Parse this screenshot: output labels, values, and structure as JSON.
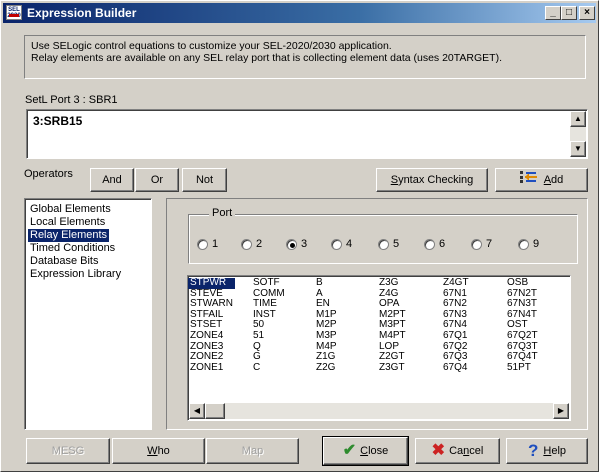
{
  "window": {
    "title": "Expression Builder",
    "icon_text": "SEL 2030",
    "controls": {
      "minimize": "_",
      "maximize": "□",
      "close": "×"
    }
  },
  "info": {
    "line1": "Use SELogic control equations to customize your SEL-2020/2030 application.",
    "line2": "Relay elements are available on any SEL relay port that is collecting element data (uses 20TARGET)."
  },
  "setting": {
    "label": "SetL  Port 3 : SBR1",
    "expression": "3:SRB15"
  },
  "operators": {
    "label": "Operators",
    "and": "And",
    "or": "Or",
    "not": "Not",
    "syntax_prefix": "S",
    "syntax_rest": "yntax Checking",
    "add_prefix": "A",
    "add_rest": "dd"
  },
  "categories": {
    "items": [
      "Global Elements",
      "Local Elements",
      "Relay Elements",
      "Timed Conditions",
      "Database Bits",
      "Expression Library"
    ],
    "selected_index": 2
  },
  "port": {
    "legend": "Port",
    "options": [
      "1",
      "2",
      "3",
      "4",
      "5",
      "6",
      "7",
      "9"
    ],
    "selected": "3"
  },
  "elements": {
    "columns": [
      [
        "STPWR",
        "STEVE",
        "STWARN",
        "STFAIL",
        "STSET",
        "ZONE4",
        "ZONE3",
        "ZONE2",
        "ZONE1"
      ],
      [
        "SOTF",
        "COMM",
        "TIME",
        "INST",
        "50",
        "51",
        "Q",
        "G",
        "C"
      ],
      [
        "B",
        "A",
        "EN",
        "M1P",
        "M2P",
        "M3P",
        "M4P",
        "Z1G",
        "Z2G"
      ],
      [
        "Z3G",
        "Z4G",
        "OPA",
        "M2PT",
        "M3PT",
        "M4PT",
        "LOP",
        "Z2GT",
        "Z3GT"
      ],
      [
        "Z4GT",
        "67N1",
        "67N2",
        "67N3",
        "67N4",
        "67Q1",
        "67Q2",
        "67Q3",
        "67Q4"
      ],
      [
        "OSB",
        "67N2T",
        "67N3T",
        "67N4T",
        "OST",
        "67Q2T",
        "67Q3T",
        "67Q4T",
        "51PT"
      ]
    ],
    "selected": "STPWR"
  },
  "bottom_buttons": {
    "mesg": "MESG",
    "who_prefix": "W",
    "who_rest": "ho",
    "map": "Map",
    "close_prefix": "C",
    "close_rest": "lose",
    "cancel_prefix": "Ca",
    "cancel_mid": "n",
    "cancel_rest": "cel",
    "help_prefix": "H",
    "help_rest": "elp"
  },
  "colors": {
    "face": "#d4d0c8",
    "selection": "#0a246a",
    "check_green": "#2e8b2e",
    "cancel_red": "#cc2222",
    "help_blue": "#1f4fbf"
  }
}
